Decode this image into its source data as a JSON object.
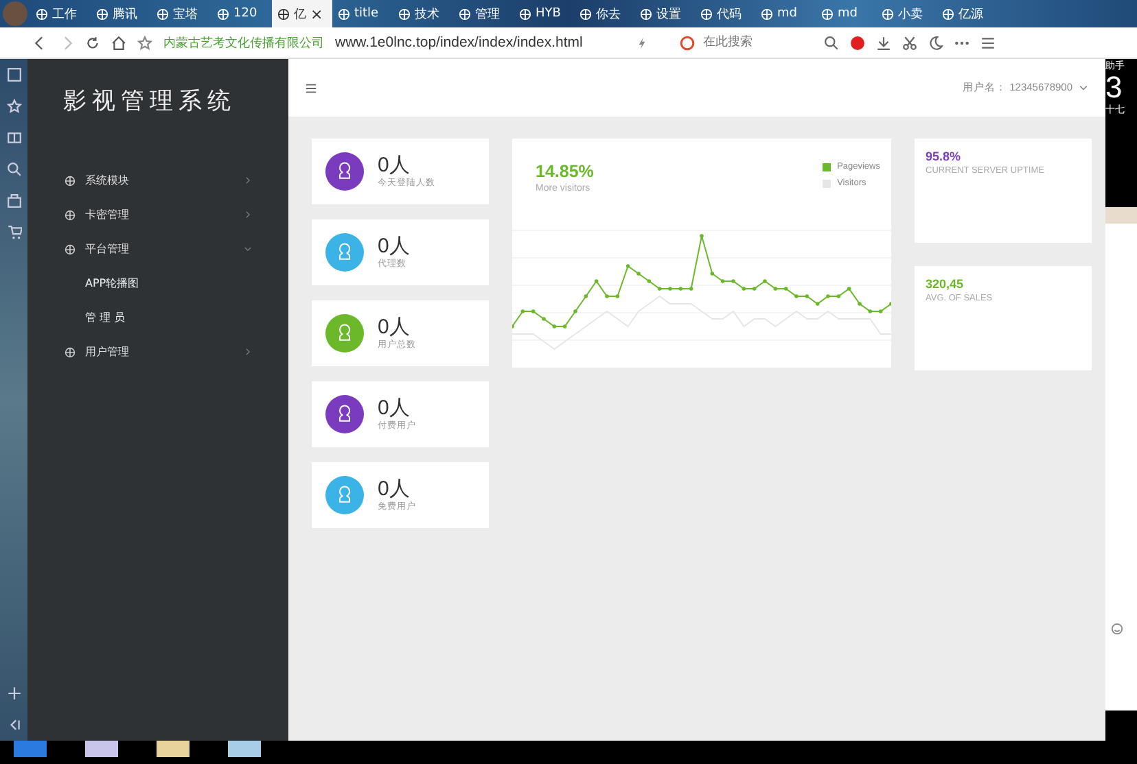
{
  "browser": {
    "tabs": [
      {
        "label": "工作",
        "selected": false
      },
      {
        "label": "腾讯",
        "selected": false
      },
      {
        "label": "宝塔",
        "selected": false
      },
      {
        "label": "120",
        "selected": false
      },
      {
        "label": "亿",
        "selected": true,
        "close": "×"
      },
      {
        "label": "title",
        "selected": false
      },
      {
        "label": "技术",
        "selected": false
      },
      {
        "label": "管理",
        "selected": false
      },
      {
        "label": "HYB",
        "selected": false
      },
      {
        "label": "你去",
        "selected": false
      },
      {
        "label": "设置",
        "selected": false
      },
      {
        "label": "代码",
        "selected": false
      },
      {
        "label": "md",
        "selected": false
      },
      {
        "label": "md",
        "selected": false
      },
      {
        "label": "小卖",
        "selected": false
      },
      {
        "label": "亿源",
        "selected": false
      }
    ],
    "site_name": "内蒙古艺考文化传播有限公司",
    "url": "www.1e0lnc.top/index/index/index.html",
    "search": {
      "placeholder": "在此搜索"
    }
  },
  "app": {
    "title": "影视管理系统",
    "user_label": "用户名：",
    "user_name": "12345678900",
    "menu": [
      {
        "label": "系统模块",
        "expanded": false
      },
      {
        "label": "卡密管理",
        "expanded": false
      },
      {
        "label": "平台管理",
        "expanded": true,
        "children": [
          {
            "label": "APP轮播图"
          },
          {
            "label": "管 理 员"
          }
        ]
      },
      {
        "label": "用户管理",
        "expanded": false
      }
    ],
    "stats": [
      {
        "value": "0人",
        "label": "今天登陆人数",
        "color": "#7b3bbf"
      },
      {
        "value": "0人",
        "label": "代理数",
        "color": "#3bb3e6"
      },
      {
        "value": "0人",
        "label": "用户总数",
        "color": "#6bb82a"
      },
      {
        "value": "0人",
        "label": "付费用户",
        "color": "#7b3bbf"
      },
      {
        "value": "0人",
        "label": "免费用户",
        "color": "#3bb3e6"
      }
    ],
    "visitors": {
      "value": "14.85%",
      "caption": "More visitors",
      "legend": [
        {
          "name": "Pageviews",
          "color": "#6bb82a"
        },
        {
          "name": "Visitors",
          "color": "#e6e6e6"
        }
      ]
    },
    "kpis": [
      {
        "value": "95.8%",
        "caption": "CURRENT SERVER UPTIME",
        "color": "#7b3bbf"
      },
      {
        "value": "320,45",
        "caption": "AVG. OF SALES",
        "color": "#6bb82a"
      }
    ]
  },
  "desktop": {
    "texts": [
      "助手",
      "3",
      "十七"
    ]
  }
}
